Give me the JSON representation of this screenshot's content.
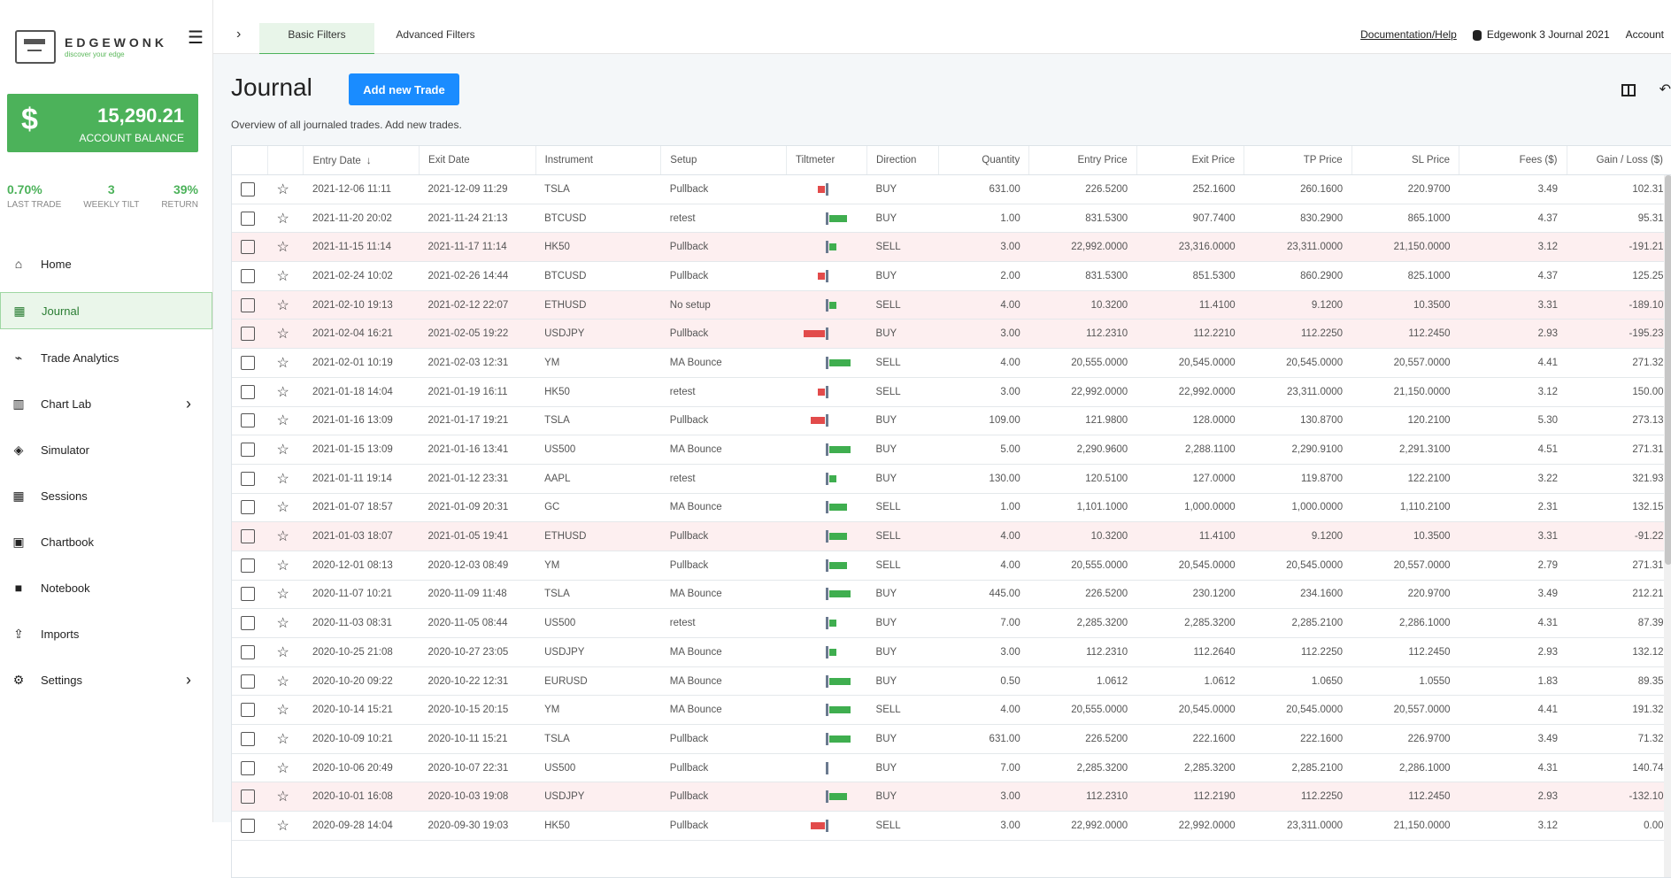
{
  "logo": {
    "name": "EDGEWONK",
    "tagline": "discover your edge"
  },
  "account": {
    "balance": "15,290.21",
    "label": "ACCOUNT BALANCE"
  },
  "stats": [
    {
      "value": "0.70%",
      "label": "LAST TRADE"
    },
    {
      "value": "3",
      "label": "WEEKLY TILT"
    },
    {
      "value": "39%",
      "label": "RETURN"
    }
  ],
  "nav": [
    {
      "label": "Home",
      "icon": "home-icon"
    },
    {
      "label": "Journal",
      "icon": "calendar-icon"
    },
    {
      "label": "Trade Analytics",
      "icon": "chart-line-icon"
    },
    {
      "label": "Chart Lab",
      "icon": "bar-chart-icon"
    },
    {
      "label": "Simulator",
      "icon": "layers-icon"
    },
    {
      "label": "Sessions",
      "icon": "grid-icon"
    },
    {
      "label": "Chartbook",
      "icon": "image-icon"
    },
    {
      "label": "Notebook",
      "icon": "note-icon"
    },
    {
      "label": "Imports",
      "icon": "upload-icon"
    },
    {
      "label": "Settings",
      "icon": "gear-icon"
    }
  ],
  "tabs": {
    "basic": "Basic Filters",
    "advanced": "Advanced Filters"
  },
  "topRight": {
    "doc": "Documentation/Help",
    "journal": "Edgewonk 3 Journal 2021",
    "account": "Account"
  },
  "page": {
    "title": "Journal",
    "addButton": "Add new Trade",
    "subtitle": "Overview of all journaled trades. Add new trades."
  },
  "columns": [
    "Entry Date",
    "Exit Date",
    "Instrument",
    "Setup",
    "Tiltmeter",
    "Direction",
    "Quantity",
    "Entry Price",
    "Exit Price",
    "TP Price",
    "SL Price",
    "Fees ($)",
    "Gain / Loss ($)"
  ],
  "trades": [
    {
      "entry": "2021-12-06 11:11",
      "exit": "2021-12-09 11:29",
      "instrument": "TSLA",
      "setup": "Pullback",
      "tilt": -2,
      "direction": "BUY",
      "qty": "631.00",
      "entryPrice": "226.5200",
      "exitPrice": "252.1600",
      "tp": "260.1600",
      "sl": "220.9700",
      "fees": "3.49",
      "gain": "102.31",
      "loss": false
    },
    {
      "entry": "2021-11-20 20:02",
      "exit": "2021-11-24 21:13",
      "instrument": "BTCUSD",
      "setup": "retest",
      "tilt": 5,
      "direction": "BUY",
      "qty": "1.00",
      "entryPrice": "831.5300",
      "exitPrice": "907.7400",
      "tp": "830.2900",
      "sl": "865.1000",
      "fees": "4.37",
      "gain": "95.31",
      "loss": false
    },
    {
      "entry": "2021-11-15 11:14",
      "exit": "2021-11-17 11:14",
      "instrument": "HK50",
      "setup": "Pullback",
      "tilt": 2,
      "direction": "SELL",
      "qty": "3.00",
      "entryPrice": "22,992.0000",
      "exitPrice": "23,316.0000",
      "tp": "23,311.0000",
      "sl": "21,150.0000",
      "fees": "3.12",
      "gain": "-191.21",
      "loss": true
    },
    {
      "entry": "2021-02-24 10:02",
      "exit": "2021-02-26 14:44",
      "instrument": "BTCUSD",
      "setup": "Pullback",
      "tilt": -2,
      "direction": "BUY",
      "qty": "2.00",
      "entryPrice": "831.5300",
      "exitPrice": "851.5300",
      "tp": "860.2900",
      "sl": "825.1000",
      "fees": "4.37",
      "gain": "125.25",
      "loss": false
    },
    {
      "entry": "2021-02-10 19:13",
      "exit": "2021-02-12 22:07",
      "instrument": "ETHUSD",
      "setup": "No setup",
      "tilt": 2,
      "direction": "SELL",
      "qty": "4.00",
      "entryPrice": "10.3200",
      "exitPrice": "11.4100",
      "tp": "9.1200",
      "sl": "10.3500",
      "fees": "3.31",
      "gain": "-189.10",
      "loss": true
    },
    {
      "entry": "2021-02-04 16:21",
      "exit": "2021-02-05 19:22",
      "instrument": "USDJPY",
      "setup": "Pullback",
      "tilt": -6,
      "direction": "BUY",
      "qty": "3.00",
      "entryPrice": "112.2310",
      "exitPrice": "112.2210",
      "tp": "112.2250",
      "sl": "112.2450",
      "fees": "2.93",
      "gain": "-195.23",
      "loss": true
    },
    {
      "entry": "2021-02-01 10:19",
      "exit": "2021-02-03 12:31",
      "instrument": "YM",
      "setup": "MA Bounce",
      "tilt": 6,
      "direction": "SELL",
      "qty": "4.00",
      "entryPrice": "20,555.0000",
      "exitPrice": "20,545.0000",
      "tp": "20,545.0000",
      "sl": "20,557.0000",
      "fees": "4.41",
      "gain": "271.32",
      "loss": false
    },
    {
      "entry": "2021-01-18 14:04",
      "exit": "2021-01-19 16:11",
      "instrument": "HK50",
      "setup": "retest",
      "tilt": -2,
      "direction": "SELL",
      "qty": "3.00",
      "entryPrice": "22,992.0000",
      "exitPrice": "22,992.0000",
      "tp": "23,311.0000",
      "sl": "21,150.0000",
      "fees": "3.12",
      "gain": "150.00",
      "loss": false
    },
    {
      "entry": "2021-01-16 13:09",
      "exit": "2021-01-17 19:21",
      "instrument": "TSLA",
      "setup": "Pullback",
      "tilt": -4,
      "direction": "BUY",
      "qty": "109.00",
      "entryPrice": "121.9800",
      "exitPrice": "128.0000",
      "tp": "130.8700",
      "sl": "120.2100",
      "fees": "5.30",
      "gain": "273.13",
      "loss": false
    },
    {
      "entry": "2021-01-15 13:09",
      "exit": "2021-01-16 13:41",
      "instrument": "US500",
      "setup": "MA Bounce",
      "tilt": 6,
      "direction": "BUY",
      "qty": "5.00",
      "entryPrice": "2,290.9600",
      "exitPrice": "2,288.1100",
      "tp": "2,290.9100",
      "sl": "2,291.3100",
      "fees": "4.51",
      "gain": "271.31",
      "loss": false
    },
    {
      "entry": "2021-01-11 19:14",
      "exit": "2021-01-12 23:31",
      "instrument": "AAPL",
      "setup": "retest",
      "tilt": 2,
      "direction": "BUY",
      "qty": "130.00",
      "entryPrice": "120.5100",
      "exitPrice": "127.0000",
      "tp": "119.8700",
      "sl": "122.2100",
      "fees": "3.22",
      "gain": "321.93",
      "loss": false
    },
    {
      "entry": "2021-01-07 18:57",
      "exit": "2021-01-09 20:31",
      "instrument": "GC",
      "setup": "MA Bounce",
      "tilt": 5,
      "direction": "SELL",
      "qty": "1.00",
      "entryPrice": "1,101.1000",
      "exitPrice": "1,000.0000",
      "tp": "1,000.0000",
      "sl": "1,110.2100",
      "fees": "2.31",
      "gain": "132.15",
      "loss": false
    },
    {
      "entry": "2021-01-03 18:07",
      "exit": "2021-01-05 19:41",
      "instrument": "ETHUSD",
      "setup": "Pullback",
      "tilt": 5,
      "direction": "SELL",
      "qty": "4.00",
      "entryPrice": "10.3200",
      "exitPrice": "11.4100",
      "tp": "9.1200",
      "sl": "10.3500",
      "fees": "3.31",
      "gain": "-91.22",
      "loss": true
    },
    {
      "entry": "2020-12-01 08:13",
      "exit": "2020-12-03 08:49",
      "instrument": "YM",
      "setup": "Pullback",
      "tilt": 5,
      "direction": "SELL",
      "qty": "4.00",
      "entryPrice": "20,555.0000",
      "exitPrice": "20,545.0000",
      "tp": "20,545.0000",
      "sl": "20,557.0000",
      "fees": "2.79",
      "gain": "271.31",
      "loss": false
    },
    {
      "entry": "2020-11-07 10:21",
      "exit": "2020-11-09 11:48",
      "instrument": "TSLA",
      "setup": "MA Bounce",
      "tilt": 6,
      "direction": "BUY",
      "qty": "445.00",
      "entryPrice": "226.5200",
      "exitPrice": "230.1200",
      "tp": "234.1600",
      "sl": "220.9700",
      "fees": "3.49",
      "gain": "212.21",
      "loss": false
    },
    {
      "entry": "2020-11-03 08:31",
      "exit": "2020-11-05 08:44",
      "instrument": "US500",
      "setup": "retest",
      "tilt": 2,
      "direction": "BUY",
      "qty": "7.00",
      "entryPrice": "2,285.3200",
      "exitPrice": "2,285.3200",
      "tp": "2,285.2100",
      "sl": "2,286.1000",
      "fees": "4.31",
      "gain": "87.39",
      "loss": false
    },
    {
      "entry": "2020-10-25 21:08",
      "exit": "2020-10-27 23:05",
      "instrument": "USDJPY",
      "setup": "MA Bounce",
      "tilt": 2,
      "direction": "BUY",
      "qty": "3.00",
      "entryPrice": "112.2310",
      "exitPrice": "112.2640",
      "tp": "112.2250",
      "sl": "112.2450",
      "fees": "2.93",
      "gain": "132.12",
      "loss": false
    },
    {
      "entry": "2020-10-20 09:22",
      "exit": "2020-10-22 12:31",
      "instrument": "EURUSD",
      "setup": "MA Bounce",
      "tilt": 6,
      "direction": "BUY",
      "qty": "0.50",
      "entryPrice": "1.0612",
      "exitPrice": "1.0612",
      "tp": "1.0650",
      "sl": "1.0550",
      "fees": "1.83",
      "gain": "89.35",
      "loss": false
    },
    {
      "entry": "2020-10-14 15:21",
      "exit": "2020-10-15 20:15",
      "instrument": "YM",
      "setup": "MA Bounce",
      "tilt": 6,
      "direction": "SELL",
      "qty": "4.00",
      "entryPrice": "20,555.0000",
      "exitPrice": "20,545.0000",
      "tp": "20,545.0000",
      "sl": "20,557.0000",
      "fees": "4.41",
      "gain": "191.32",
      "loss": false
    },
    {
      "entry": "2020-10-09 10:21",
      "exit": "2020-10-11 15:21",
      "instrument": "TSLA",
      "setup": "Pullback",
      "tilt": 6,
      "direction": "BUY",
      "qty": "631.00",
      "entryPrice": "226.5200",
      "exitPrice": "222.1600",
      "tp": "222.1600",
      "sl": "226.9700",
      "fees": "3.49",
      "gain": "71.32",
      "loss": false
    },
    {
      "entry": "2020-10-06 20:49",
      "exit": "2020-10-07 22:31",
      "instrument": "US500",
      "setup": "Pullback",
      "tilt": 0,
      "direction": "BUY",
      "qty": "7.00",
      "entryPrice": "2,285.3200",
      "exitPrice": "2,285.3200",
      "tp": "2,285.2100",
      "sl": "2,286.1000",
      "fees": "4.31",
      "gain": "140.74",
      "loss": false
    },
    {
      "entry": "2020-10-01 16:08",
      "exit": "2020-10-03 19:08",
      "instrument": "USDJPY",
      "setup": "Pullback",
      "tilt": 5,
      "direction": "BUY",
      "qty": "3.00",
      "entryPrice": "112.2310",
      "exitPrice": "112.2190",
      "tp": "112.2250",
      "sl": "112.2450",
      "fees": "2.93",
      "gain": "-132.10",
      "loss": true
    },
    {
      "entry": "2020-09-28 14:04",
      "exit": "2020-09-30 19:03",
      "instrument": "HK50",
      "setup": "Pullback",
      "tilt": -4,
      "direction": "SELL",
      "qty": "3.00",
      "entryPrice": "22,992.0000",
      "exitPrice": "22,992.0000",
      "tp": "23,311.0000",
      "sl": "21,150.0000",
      "fees": "3.12",
      "gain": "0.00",
      "loss": false
    }
  ]
}
